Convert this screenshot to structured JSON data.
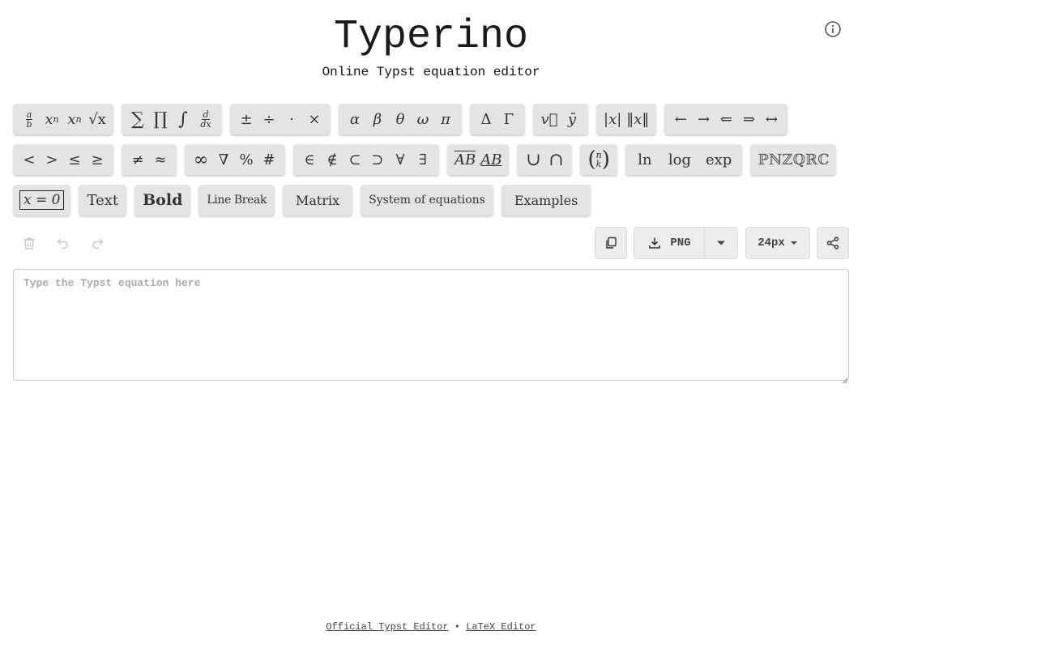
{
  "header": {
    "title": "Typerino",
    "subtitle": "Online Typst equation editor"
  },
  "icons": {
    "info": "info-circle-icon",
    "delete": "trash-icon",
    "undo": "undo-icon",
    "redo": "redo-icon",
    "copy": "copy-icon",
    "download": "download-icon",
    "dropdown": "caret-down-icon",
    "share": "share-icon"
  },
  "symbols": {
    "xn_base": "x",
    "xn_sup": "n",
    "xsub_base": "x",
    "xsub_sub": "n",
    "sqrt": "√x",
    "sum": "∑",
    "prod": "∏",
    "int": "∫",
    "pm": "±",
    "div": "÷",
    "cdot": "·",
    "times": "×",
    "alpha": "α",
    "beta": "β",
    "theta": "θ",
    "omega": "ω",
    "pi": "π",
    "Delta": "Δ",
    "Gamma": "Γ",
    "vec": "v⃗",
    "bar": "ȳ",
    "abs": "|x|",
    "norm": "‖x‖",
    "larrow": "←",
    "rarrow": "→",
    "lArrow": "⇐",
    "rArrow": "⇒",
    "lrarrow": "↔",
    "lt": "<",
    "gt": ">",
    "le": "≤",
    "ge": "≥",
    "ne": "≠",
    "approx": "≈",
    "infty": "∞",
    "nabla": "∇",
    "percent": "%",
    "hash": "#",
    "in": "∈",
    "notin": "∉",
    "subset": "⊂",
    "supset": "⊃",
    "forall": "∀",
    "exists": "∃",
    "overline": "AB",
    "underline": "AB",
    "union": "∪",
    "intersect": "∩",
    "ln": "ln",
    "log": "log",
    "exp": "exp",
    "sets": "ℙℕℤℚℝℂ",
    "frac_num": "a",
    "frac_den": "b",
    "deriv_num": "d",
    "deriv_den": "dx",
    "binom_n": "n",
    "binom_k": "k",
    "binom_open": "(",
    "binom_close": ")"
  },
  "buttons": {
    "box": "x = 0",
    "text": "Text",
    "bold": "Bold",
    "linebreak": "Line Break",
    "matrix": "Matrix",
    "system": "System of equations",
    "examples": "Examples"
  },
  "toolbar": {
    "format": "PNG",
    "size": "24px"
  },
  "editor": {
    "placeholder": "Type the Typst equation here",
    "value": ""
  },
  "footer": {
    "link1": "Official Typst Editor",
    "separator": "•",
    "link2": "LaTeX Editor"
  }
}
